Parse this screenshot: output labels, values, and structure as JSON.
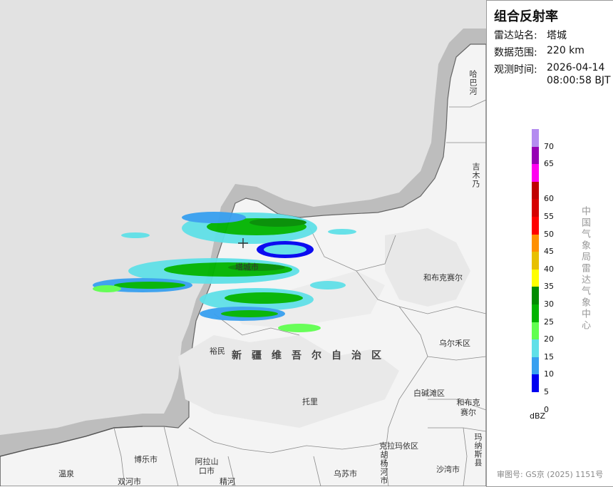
{
  "panel": {
    "title": "组合反射率",
    "station_label": "雷达站名:",
    "station_value": "塔城",
    "range_label": "数据范围:",
    "range_value": "220 km",
    "time_label": "观测时间:",
    "time_date": "2026-04-14",
    "time_clock": "08:00:58 BJT",
    "credit": "中国气象局雷达气象中心",
    "review": "审图号: GS京 (2025) 1151号"
  },
  "legend": {
    "unit": "dBZ",
    "levels": [
      {
        "label": "70",
        "color": "#b48cf0"
      },
      {
        "label": "65",
        "color": "#9600b4"
      },
      {
        "label": "",
        "color": "#ff00f0"
      },
      {
        "label": "60",
        "color": "#c00000"
      },
      {
        "label": "55",
        "color": "#d60000"
      },
      {
        "label": "50",
        "color": "#ff0000"
      },
      {
        "label": "45",
        "color": "#ff9000"
      },
      {
        "label": "40",
        "color": "#e7c000"
      },
      {
        "label": "35",
        "color": "#ffff00"
      },
      {
        "label": "30",
        "color": "#008c00"
      },
      {
        "label": "25",
        "color": "#00b400"
      },
      {
        "label": "20",
        "color": "#60ff50"
      },
      {
        "label": "15",
        "color": "#60e0e8"
      },
      {
        "label": "10",
        "color": "#38a0f0"
      },
      {
        "label": "5",
        "color": "#0000f0"
      },
      {
        "label": "0",
        "color": ""
      }
    ]
  },
  "map": {
    "places": {
      "habahe": "哈巴河",
      "jimunai": "吉木乃",
      "hebukesaier": "和布克赛尔",
      "tacheng": "塔城市",
      "yumin": "裕民",
      "wuerhe": "乌尔禾区",
      "baijiantan": "白碱滩区",
      "hebukesaier2": "和布克赛尔",
      "tuoli": "托里",
      "kelamayi": "克拉玛依区",
      "manasi": "玛纳斯县",
      "bole": "博乐市",
      "alashankou": "阿拉山口市",
      "wenquan": "温泉",
      "shuanghe": "双河市",
      "jinghe": "精河",
      "wusu": "乌苏市",
      "huyanghe": "胡杨河市",
      "shawan": "沙湾市",
      "region": "新疆维吾尔自治区"
    }
  }
}
